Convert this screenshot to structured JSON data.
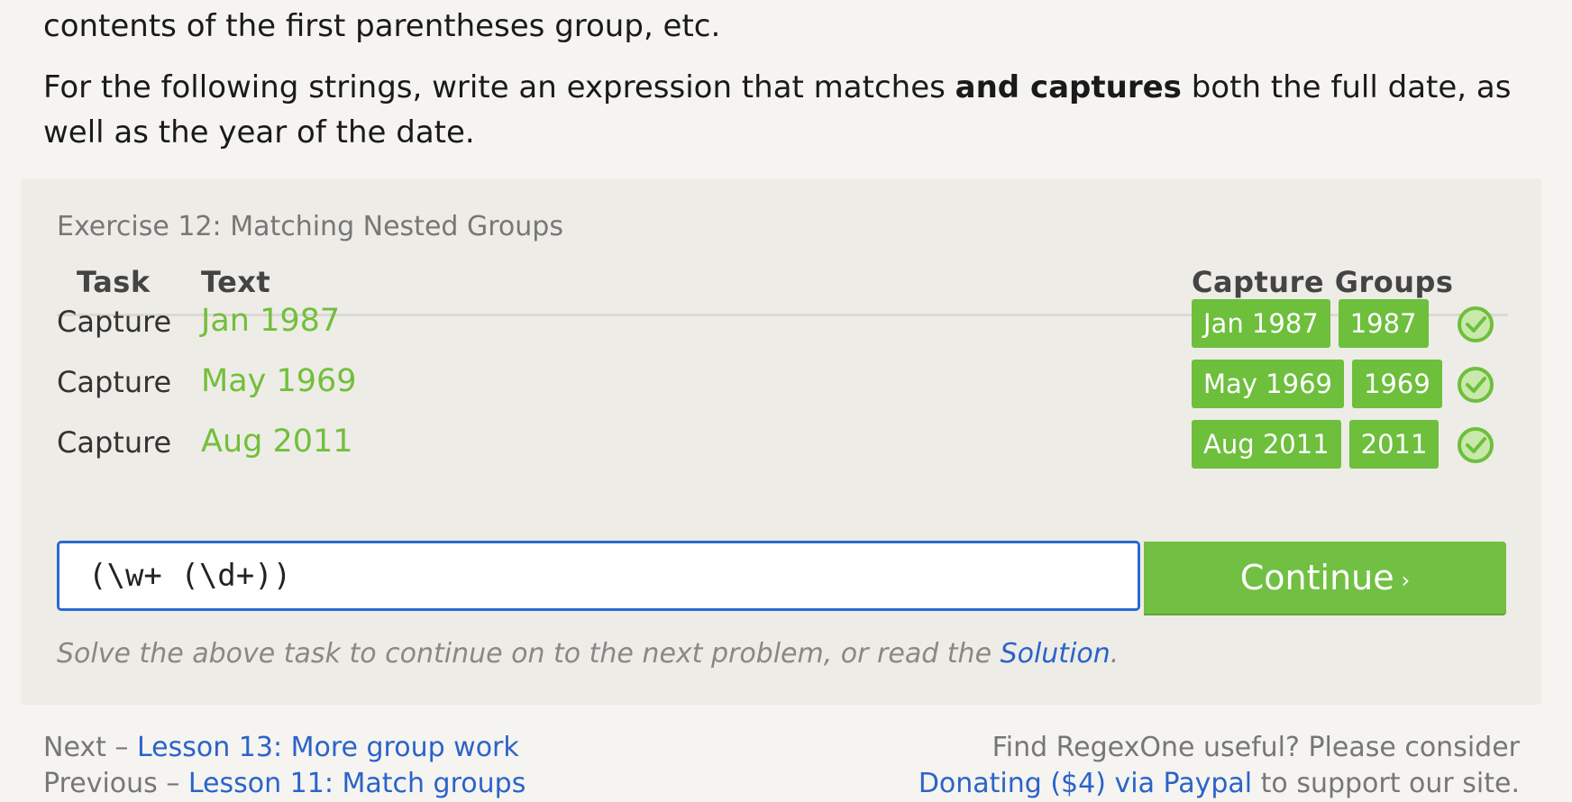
{
  "intro": {
    "line1": "contents of the first parentheses group, etc.",
    "p2_before": "For the following strings, write an expression that matches ",
    "p2_bold": "and captures",
    "p2_after": " both the full date, as well as the year of the date."
  },
  "exercise": {
    "title": "Exercise 12: Matching Nested Groups",
    "headers": {
      "task": "Task",
      "text": "Text",
      "groups": "Capture Groups"
    },
    "rows": [
      {
        "task": "Capture",
        "text": "Jan 1987",
        "groups": [
          "Jan 1987",
          "1987"
        ],
        "status": "check-icon"
      },
      {
        "task": "Capture",
        "text": "May 1969",
        "groups": [
          "May 1969",
          "1969"
        ],
        "status": "check-icon"
      },
      {
        "task": "Capture",
        "text": "Aug 2011",
        "groups": [
          "Aug 2011",
          "2011"
        ],
        "status": "check-icon"
      }
    ],
    "answer_value": "(\\w+ (\\d+))",
    "continue_label": "Continue",
    "continue_icon": "›",
    "hint_before": "Solve the above task to continue on to the next problem, or read the ",
    "hint_link": "Solution",
    "hint_after": "."
  },
  "footer": {
    "next_prefix": "Next – ",
    "next_link": "Lesson 13: More group work",
    "prev_prefix": "Previous – ",
    "prev_link": "Lesson 11: Match groups",
    "right_line1": "Find RegexOne useful? Please consider",
    "right_link": "Donating ($4) via Paypal",
    "right_after": " to support our site."
  },
  "colors": {
    "accent_green": "#72c043",
    "link_blue": "#2b63c9",
    "input_border": "#2a6ad0"
  }
}
